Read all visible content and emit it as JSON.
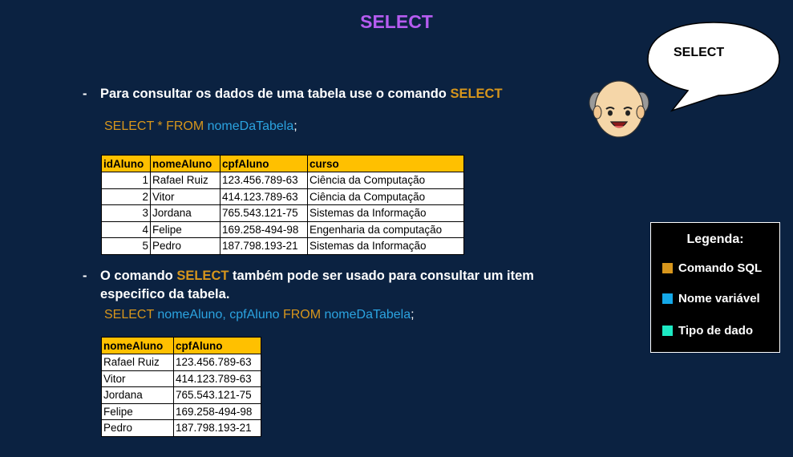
{
  "page": {
    "title": "SELECT"
  },
  "speech_bubble": {
    "text": "SELECT"
  },
  "section1": {
    "dash": "-",
    "text_prefix": "Para consultar os dados de uma tabela use o comando ",
    "text_keyword": "SELECT",
    "code": {
      "kw1": "SELECT * FROM ",
      "var": "nomeDaTabela",
      "end": ";"
    },
    "table": {
      "headers": [
        "idAluno",
        "nomeAluno",
        "cpfAluno",
        "curso"
      ],
      "rows": [
        [
          "1",
          "Rafael Ruiz",
          "123.456.789-63",
          "Ciência da Computação"
        ],
        [
          "2",
          "Vitor",
          "414.123.789-63",
          "Ciência da Computação"
        ],
        [
          "3",
          "Jordana",
          "765.543.121-75",
          "Sistemas da Informação"
        ],
        [
          "4",
          "Felipe",
          "169.258-494-98",
          "Engenharia da computação"
        ],
        [
          "5",
          "Pedro",
          "187.798.193-21",
          "Sistemas da Informação"
        ]
      ]
    }
  },
  "section2": {
    "dash": "-",
    "text_prefix": "O comando ",
    "text_keyword": "SELECT",
    "text_suffix_line1": " também pode ser usado para consultar um item",
    "text_line2": "especifico da tabela.",
    "code": {
      "kw1": "SELECT ",
      "vars": "nomeAluno, cpfAluno ",
      "kw2": "FROM ",
      "var": "nomeDaTabela",
      "end": ";"
    },
    "table": {
      "headers": [
        "nomeAluno",
        "cpfAluno"
      ],
      "rows": [
        [
          "Rafael Ruiz",
          "123.456.789-63"
        ],
        [
          "Vitor",
          "414.123.789-63"
        ],
        [
          "Jordana",
          "765.543.121-75"
        ],
        [
          "Felipe",
          "169.258-494-98"
        ],
        [
          "Pedro",
          "187.798.193-21"
        ]
      ]
    }
  },
  "legend": {
    "title": "Legenda:",
    "items": [
      {
        "label": "Comando SQL",
        "color": "#d7961c"
      },
      {
        "label": "Nome variável",
        "color": "#14a8e8"
      },
      {
        "label": "Tipo de dado",
        "color": "#1de9c3"
      }
    ]
  },
  "colors": {
    "background": "#0b2241",
    "title": "#b65cf0",
    "keyword": "#d7961c",
    "variable": "#2ba3e0",
    "table_header": "#ffc000"
  }
}
